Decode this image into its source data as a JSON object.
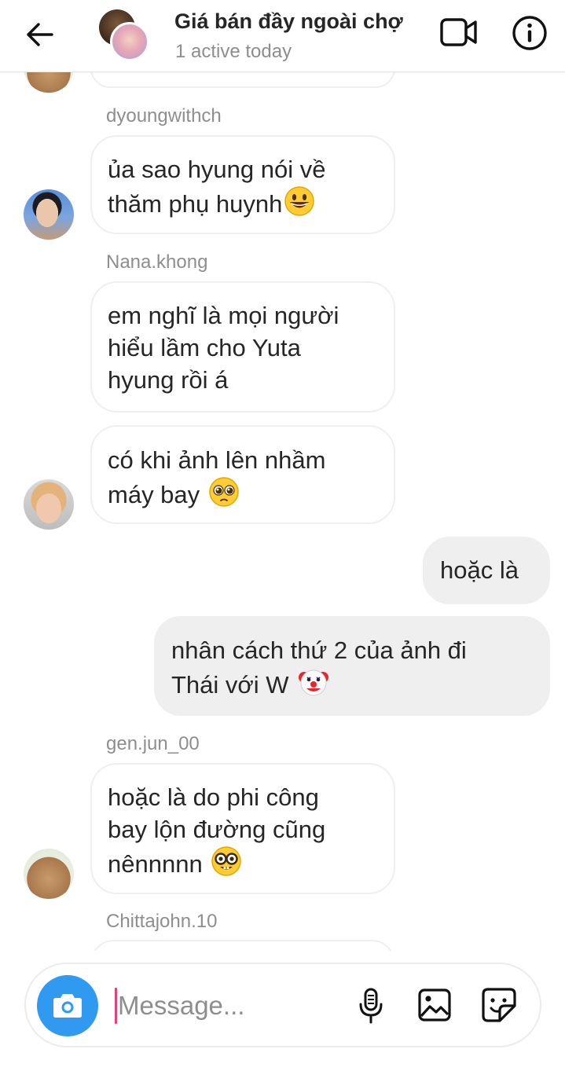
{
  "header": {
    "title": "Giá bán đầy ngoài chợ",
    "status": "1 active today",
    "back_icon": "arrow-left-icon",
    "video_icon": "video-camera-icon",
    "info_icon": "info-icon"
  },
  "messages": {
    "senders": {
      "s1": "dyoungwithch",
      "s2": "Nana.khong",
      "s3": "gen.jun_00",
      "s4": "Chittajohn.10"
    },
    "m1": {
      "l1": "ủa sao hyung nói về",
      "l2": "thăm phụ huynh",
      "emoji": "grinning-face"
    },
    "m2": {
      "l1": "em nghĩ là mọi người",
      "l2": "hiểu lầm cho Yuta",
      "l3": "hyung rồi á"
    },
    "m3": {
      "l1": "có khi ảnh lên nhầm",
      "l2": "máy bay ",
      "emoji": "pleading-face"
    },
    "m4": {
      "l1": "hoặc là"
    },
    "m5": {
      "l1": "nhân cách thứ 2 của ảnh đi",
      "l2": "Thái với W ",
      "emoji": "clown-face"
    },
    "m6": {
      "l1": "hoặc là do phi công",
      "l2": "bay lộn đường cũng",
      "l3": "nênnnnn ",
      "emoji": "nerd-face"
    }
  },
  "composer": {
    "placeholder": "Message...",
    "camera_icon": "camera-icon",
    "mic_icon": "microphone-icon",
    "gallery_icon": "image-icon",
    "sticker_icon": "sticker-icon"
  },
  "colors": {
    "camera_button": "#2f9aef",
    "caret": "#e2417b",
    "outgoing_bubble": "#efefef",
    "secondary_text": "#8e8e8e"
  }
}
